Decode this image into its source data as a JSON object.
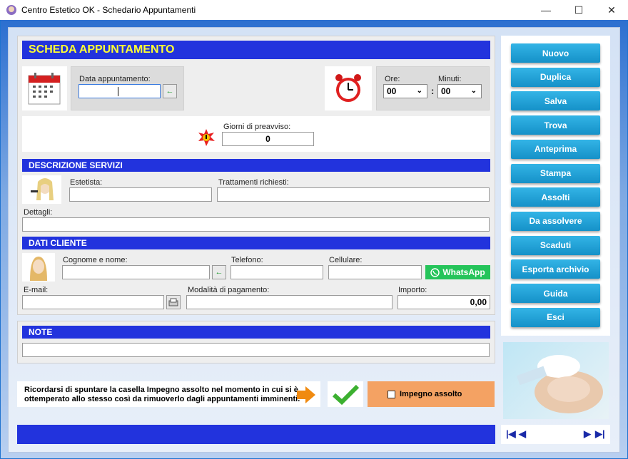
{
  "window": {
    "title": "Centro Estetico OK - Schedario Appuntamenti",
    "minimize": "—",
    "maximize": "☐",
    "close": "✕"
  },
  "form": {
    "header": "SCHEDA APPUNTAMENTO",
    "date_label": "Data appuntamento:",
    "date_value": "",
    "ore_label": "Ore:",
    "ore_value": "00",
    "minuti_label": "Minuti:",
    "minuti_value": "00",
    "time_sep": ":",
    "preavviso_label": "Giorni di preavviso:",
    "preavviso_value": "0"
  },
  "servizi": {
    "header": "DESCRIZIONE SERVIZI",
    "estetista_label": "Estetista:",
    "trattamenti_label": "Trattamenti richiesti:",
    "dettagli_label": "Dettagli:"
  },
  "cliente": {
    "header": "DATI CLIENTE",
    "nome_label": "Cognome e nome:",
    "telefono_label": "Telefono:",
    "cellulare_label": "Cellulare:",
    "whatsapp": "WhatsApp",
    "email_label": "E-mail:",
    "pagamento_label": "Modalità di pagamento:",
    "importo_label": "Importo:",
    "importo_value": "0,00"
  },
  "note": {
    "header": "NOTE"
  },
  "reminder": {
    "text": "Ricordarsi di spuntare la casella Impegno assolto nel momento in cui si è ottemperato allo stesso così da rimuoverlo dagli appuntamenti imminenti.",
    "checkbox_label": "Impegno assolto",
    "checked": false
  },
  "buttons": [
    "Nuovo",
    "Duplica",
    "Salva",
    "Trova",
    "Anteprima",
    "Stampa",
    "Assolti",
    "Da assolvere",
    "Scaduti",
    "Esporta archivio",
    "Guida",
    "Esci"
  ],
  "nav": {
    "first": "|◀",
    "prev": "◀",
    "next": "▶",
    "last": "▶|"
  },
  "colors": {
    "header_blue": "#2233dd",
    "button_blue": "#1b9ad3",
    "whatsapp_green": "#25c45a",
    "checkbox_orange": "#f4a263"
  }
}
